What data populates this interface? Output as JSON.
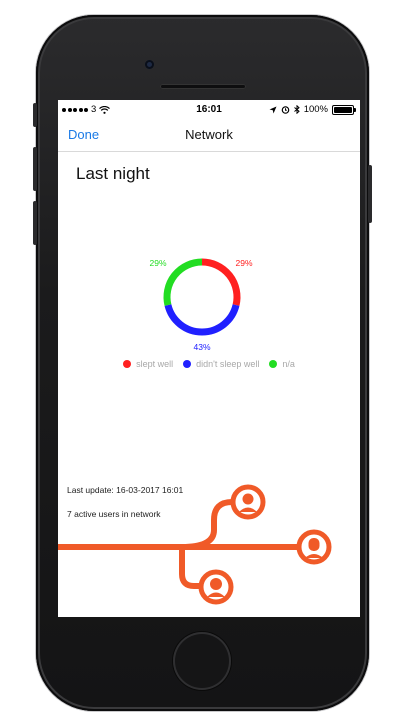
{
  "statusbar": {
    "carrier": "3",
    "time": "16:01",
    "battery": "100%"
  },
  "navbar": {
    "done_label": "Done",
    "title": "Network"
  },
  "section": {
    "title": "Last night"
  },
  "colors": {
    "slept_well": "#ff2020",
    "didnt_sleep_well": "#2020ff",
    "na": "#22dd22",
    "accent": "#f05a28",
    "link": "#1a7ae6"
  },
  "chart_data": {
    "type": "pie",
    "categories": [
      "slept well",
      "didn't sleep well",
      "n/a"
    ],
    "values": [
      29,
      43,
      29
    ],
    "labels": [
      "29%",
      "43%",
      "29%"
    ],
    "donut": true,
    "legend": "bottom"
  },
  "legend": {
    "items": [
      "slept well",
      "didn't sleep well",
      "n/a"
    ]
  },
  "info": {
    "last_update": "Last update: 16-03-2017 16:01",
    "active_users": "7 active users in network"
  },
  "icons": [
    "wifi-icon",
    "location-icon",
    "alarm-icon",
    "bluetooth-icon",
    "battery-icon",
    "user-avatar-icon"
  ]
}
